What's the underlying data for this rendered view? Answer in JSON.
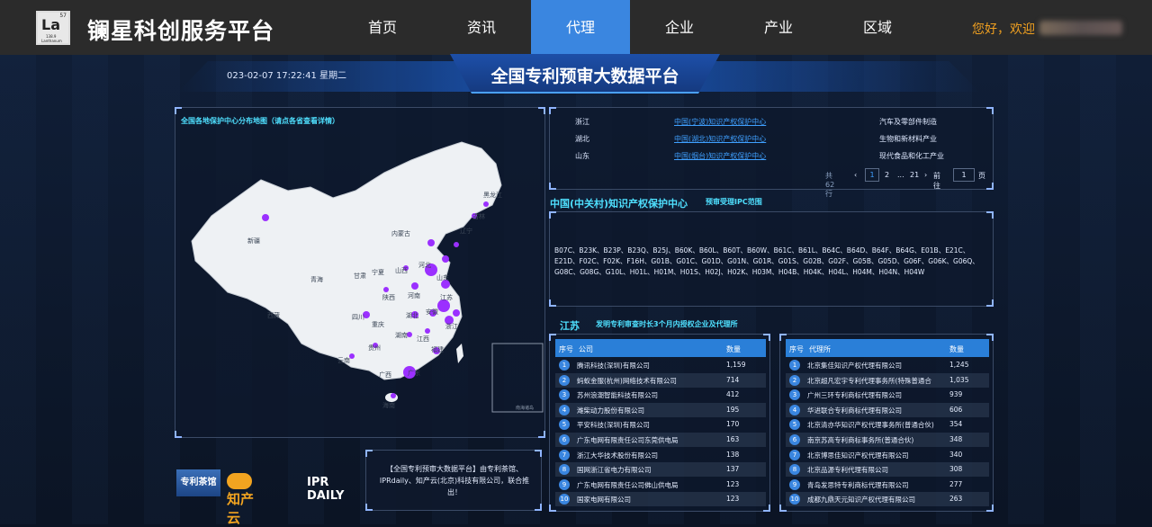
{
  "header": {
    "logo": {
      "symbol": "La",
      "number": "57",
      "mass": "138.9",
      "name": "Lanthanum"
    },
    "site_title": "镧星科创服务平台",
    "nav": [
      "首页",
      "资讯",
      "代理",
      "企业",
      "产业",
      "区域"
    ],
    "active_nav": "代理",
    "greeting": "您好，欢迎"
  },
  "banner": {
    "title": "全国专利预审大数据平台",
    "datetime": "023-02-07 17:22:41 星期二"
  },
  "map": {
    "title": "全国各地保护中心分布地图（请点各省查看详情）",
    "provinces": [
      "新疆",
      "西藏",
      "青海",
      "甘肃",
      "四川",
      "云南",
      "内蒙古",
      "宁夏",
      "陕西",
      "山西",
      "河南",
      "湖北",
      "湖南",
      "贵州",
      "重庆",
      "广西",
      "广东",
      "江西",
      "安徽",
      "江苏",
      "山东",
      "河北",
      "辽宁",
      "吉林",
      "黑龙江",
      "福建",
      "浙江",
      "海南"
    ],
    "scale_label": "南海诸岛"
  },
  "top_table": {
    "rows": [
      {
        "region": "浙江",
        "center": "中国(宁波)知识产权保护中心",
        "industry": "汽车及零部件制造"
      },
      {
        "region": "湖北",
        "center": "中国(湖北)知识产权保护中心",
        "industry": "生物和新材料产业"
      },
      {
        "region": "山东",
        "center": "中国(烟台)知识产权保护中心",
        "industry": "现代食品和化工产业"
      }
    ],
    "pager": {
      "total": "共62行",
      "pages": [
        "1",
        "2",
        "...",
        "21"
      ],
      "goto_label": "前往",
      "page_value": "1",
      "page_unit": "页"
    }
  },
  "ipc": {
    "title": "中国(中关村)知识产权保护中心",
    "subtitle": "预审受理IPC范围",
    "codes": "B07C、B23K、B23P、B23Q、B25J、B60K、B60L、B60T、B60W、B61C、B61L、B64C、B64D、B64F、B64G、E01B、E21C、E21D、F02C、F02K、F16H、G01B、G01C、G01D、G01N、G01R、G01S、G02B、G02F、G05B、G05D、G06F、G06K、G06Q、G08C、G08G、G10L、H01L、H01M、H01S、H02J、H02K、H03M、H04B、H04K、H04L、H04M、H04N、H04W"
  },
  "ranking": {
    "province": "江苏",
    "subtitle": "发明专利审查时长3个月内授权企业及代理所",
    "companies": {
      "headers": [
        "序号",
        "公司",
        "数量"
      ],
      "rows": [
        {
          "idx": "1",
          "name": "腾讯科技(深圳)有限公司",
          "count": "1,159"
        },
        {
          "idx": "2",
          "name": "蚂蚁金服(杭州)网络技术有限公司",
          "count": "714"
        },
        {
          "idx": "3",
          "name": "苏州浪潮智能科技有限公司",
          "count": "412"
        },
        {
          "idx": "4",
          "name": "潍柴动力股份有限公司",
          "count": "195"
        },
        {
          "idx": "5",
          "name": "平安科技(深圳)有限公司",
          "count": "170"
        },
        {
          "idx": "6",
          "name": "广东电网有限责任公司东莞供电局",
          "count": "163"
        },
        {
          "idx": "7",
          "name": "浙江大华技术股份有限公司",
          "count": "138"
        },
        {
          "idx": "8",
          "name": "国网浙江省电力有限公司",
          "count": "137"
        },
        {
          "idx": "9",
          "name": "广东电网有限责任公司佛山供电局",
          "count": "123"
        },
        {
          "idx": "10",
          "name": "国家电网有限公司",
          "count": "123"
        }
      ]
    },
    "agencies": {
      "headers": [
        "序号",
        "代理所",
        "数量"
      ],
      "rows": [
        {
          "idx": "1",
          "name": "北京集佳知识产权代理有限公司",
          "count": "1,245"
        },
        {
          "idx": "2",
          "name": "北京超凡宏宇专利代理事务所(特殊普通合",
          "count": "1,035"
        },
        {
          "idx": "3",
          "name": "广州三环专利商标代理有限公司",
          "count": "939"
        },
        {
          "idx": "4",
          "name": "华进联合专利商标代理有限公司",
          "count": "606"
        },
        {
          "idx": "5",
          "name": "北京清亦华知识产权代理事务所(普通合伙)",
          "count": "354"
        },
        {
          "idx": "6",
          "name": "南京苏高专利商标事务所(普通合伙)",
          "count": "348"
        },
        {
          "idx": "7",
          "name": "北京博思佳知识产权代理有限公司",
          "count": "340"
        },
        {
          "idx": "8",
          "name": "北京品源专利代理有限公司",
          "count": "308"
        },
        {
          "idx": "9",
          "name": "青岛发思特专利商标代理有限公司",
          "count": "277"
        },
        {
          "idx": "10",
          "name": "成都九鼎天元知识产权代理有限公司",
          "count": "263"
        }
      ]
    }
  },
  "partners": {
    "p1": "专利茶馆",
    "p2": "知产云",
    "p3": "IPR DAILY"
  },
  "intro": "【全国专利预审大数据平台】由专利茶馆、IPRdaily、知产云(北京)科技有限公司，联合推出！"
}
